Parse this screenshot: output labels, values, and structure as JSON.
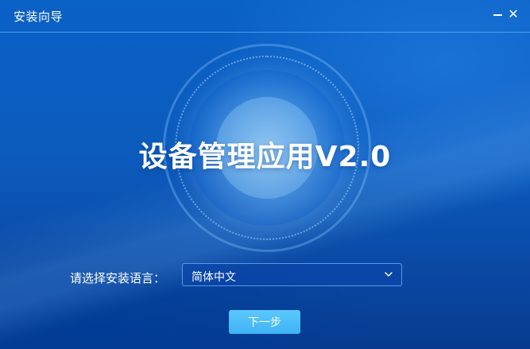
{
  "window": {
    "title": "安装向导",
    "minimize_glyph": "—",
    "close_glyph": "✕"
  },
  "app": {
    "title": "设备管理应用V2.0"
  },
  "language": {
    "label": "请选择安装语言：",
    "selected": "简体中文"
  },
  "buttons": {
    "next": "下一步"
  },
  "colors": {
    "background": "#0a5bc0",
    "next_button": "#4bbcf8",
    "titlebar_line": "#78d2ff"
  },
  "icons": {
    "minimize": "minimize-icon",
    "close": "close-icon",
    "dropdown": "chevron-down-icon"
  }
}
